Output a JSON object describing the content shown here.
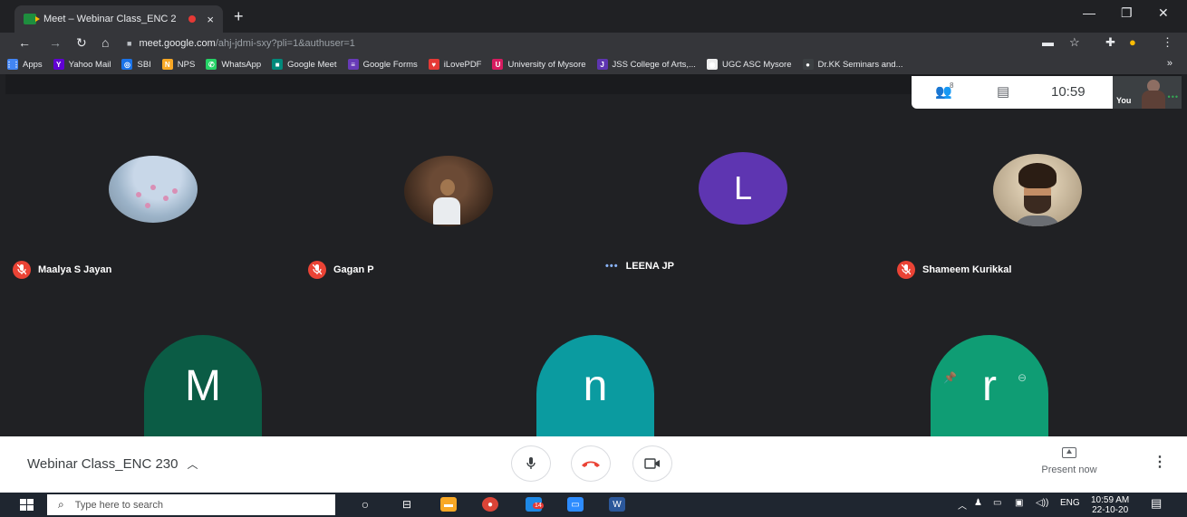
{
  "browser": {
    "tab_title": "Meet – Webinar Class_ENC 2",
    "tab_close": "×",
    "new_tab": "+",
    "url_host": "meet.google.com",
    "url_path": "/ahj-jdmi-sxy?pli=1&authuser=1",
    "window_controls": [
      "—",
      "❐",
      "✕"
    ]
  },
  "bookmarks": [
    {
      "label": "Apps",
      "color": "#4285f4",
      "glyph": "⋮⋮"
    },
    {
      "label": "Yahoo Mail",
      "color": "#6001d2",
      "glyph": "Y"
    },
    {
      "label": "SBI",
      "color": "#1a73e8",
      "glyph": "◎"
    },
    {
      "label": "NPS",
      "color": "#f9a825",
      "glyph": "N"
    },
    {
      "label": "WhatsApp",
      "color": "#25d366",
      "glyph": "✆"
    },
    {
      "label": "Google Meet",
      "color": "#00897b",
      "glyph": "■"
    },
    {
      "label": "Google Forms",
      "color": "#673ab7",
      "glyph": "≡"
    },
    {
      "label": "iLovePDF",
      "color": "#e53935",
      "glyph": "♥"
    },
    {
      "label": "University of Mysore",
      "color": "#d81b60",
      "glyph": "U"
    },
    {
      "label": "JSS College of Arts,...",
      "color": "#5e35b1",
      "glyph": "J"
    },
    {
      "label": "UGC ASC Mysore",
      "color": "#eeeeee",
      "glyph": "◉"
    },
    {
      "label": "Dr.KK Seminars and...",
      "color": "#3c4043",
      "glyph": "●"
    }
  ],
  "bookmarks_more": "»",
  "meet": {
    "clock": "10:59",
    "participants_count": "8",
    "self_label": "You",
    "participants_row1": [
      {
        "name": "Maalya S Jayan",
        "muted": true
      },
      {
        "name": "Gagan P",
        "muted": true
      },
      {
        "name": "LEENA JP",
        "muted": false,
        "initial": "L",
        "color": "#5e35b1"
      },
      {
        "name": "Shameem Kurikkal",
        "muted": true
      }
    ],
    "participants_row2": [
      {
        "initial": "M",
        "color": "#0b5c45"
      },
      {
        "initial": "n",
        "color": "#0b9ba0"
      },
      {
        "initial": "r",
        "color": "#0f9d74"
      }
    ],
    "meeting_name": "Webinar Class_ENC 230",
    "present_label": "Present now",
    "colors": {
      "end_call": "#ea4335",
      "muted": "#ea4335"
    }
  },
  "taskbar": {
    "search_placeholder": "Type here to search",
    "time": "10:59 AM",
    "date": "22-10-20",
    "lang": "ENG",
    "badge": "14"
  }
}
